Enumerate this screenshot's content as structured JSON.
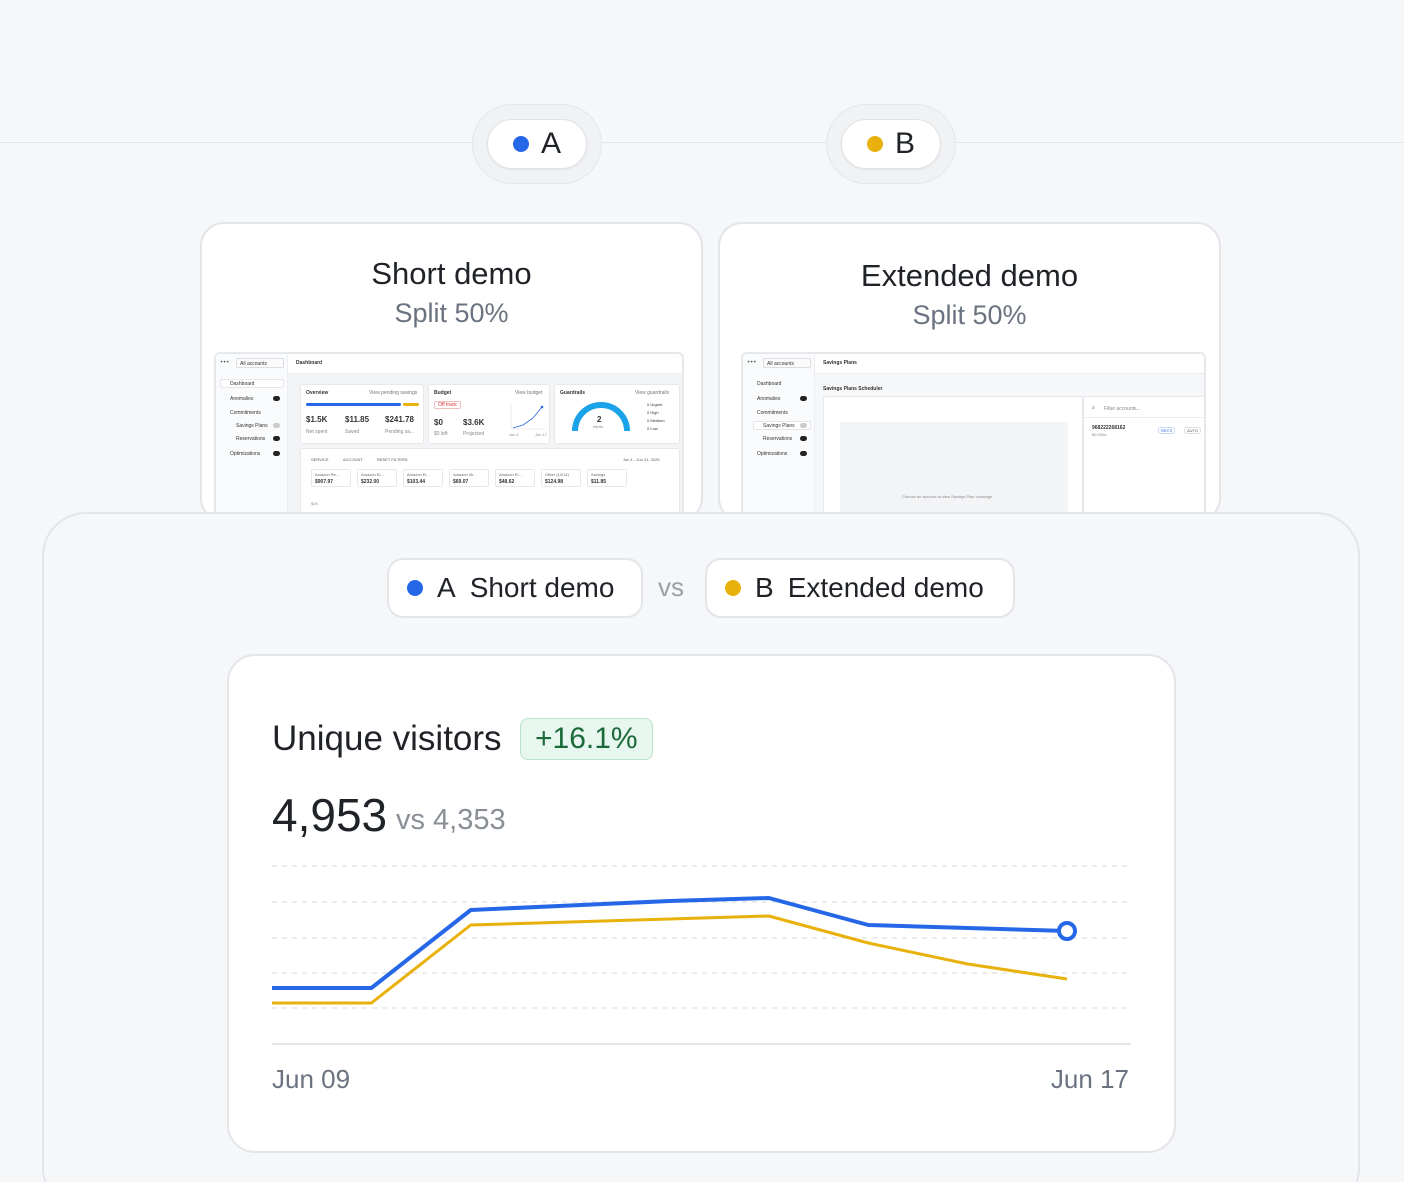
{
  "variants": {
    "a": {
      "letter": "A",
      "color": "#2667e8"
    },
    "b": {
      "letter": "B",
      "color": "#e8b10c"
    }
  },
  "demo_cards": {
    "a": {
      "title": "Short demo",
      "split": "Split 50%",
      "preview": {
        "account_select": "All accounts",
        "page": "Dashboard",
        "nav": [
          "Dashboard",
          "Anomalies",
          "Commitments",
          "Savings Plans",
          "Reservations",
          "Optimizations"
        ],
        "overview": {
          "title": "Overview",
          "link": "View pending savings",
          "values": [
            "$1.5K",
            "$11.85",
            "$241.78"
          ],
          "legend": [
            "Net spent",
            "Saved",
            "Pending sa..."
          ]
        },
        "budget": {
          "title": "Budget",
          "link": "View budget",
          "status": "Off track",
          "values": [
            "$0",
            "$3.6K"
          ],
          "legend": [
            "$0 left",
            "Projected"
          ],
          "x_labels": [
            "Jun 1",
            "Jun 17"
          ]
        },
        "guardrails": {
          "title": "Guardrails",
          "link": "View guardrails",
          "count": "2",
          "count_label": "Alerts",
          "levels": [
            "0 Urgent",
            "0 High",
            "0 Medium",
            "0 Low"
          ]
        },
        "filters": [
          "SERVICE",
          "ACCOUNT",
          "RESET FILTERS"
        ],
        "date_range": "Jun 1 - Jun 21, 2025",
        "service_tiles": [
          {
            "name": "Amazon Re...",
            "value": "$907.97"
          },
          {
            "name": "Amazon El...",
            "value": "$232.00"
          },
          {
            "name": "Amazon El...",
            "value": "$103.44"
          },
          {
            "name": "Amazon Vir...",
            "value": "$69.07"
          },
          {
            "name": "Amazon El...",
            "value": "$48.62"
          },
          {
            "name": "Other (14/14)",
            "value": "$124.98"
          },
          {
            "name": "Savings",
            "value": "$11.85"
          }
        ],
        "axis_label": "$1K"
      }
    },
    "b": {
      "title": "Extended demo",
      "split": "Split 50%",
      "preview": {
        "account_select": "All accounts",
        "page": "Savings Plans",
        "nav": [
          "Dashboard",
          "Anomalies",
          "Commitments",
          "Savings Plans",
          "Reservations",
          "Optimizations"
        ],
        "scheduler_title": "Savings Plans Scheduler",
        "empty_state": "Choose an account to view Savings Plan coverage.",
        "filter_placeholder": "Filter accounts...",
        "account_id": "968222268162",
        "account_sub": "$0.00/hr",
        "tags": [
          "RECS",
          "AUTO"
        ]
      }
    }
  },
  "comparison": {
    "a_label": "Short demo",
    "b_label": "Extended demo",
    "vs": "vs"
  },
  "metric": {
    "title": "Unique visitors",
    "delta": "+16.1%",
    "value": "4,953",
    "compare": "vs 4,353"
  },
  "chart_data": {
    "type": "line",
    "x": [
      "Jun 09",
      "Jun 10",
      "Jun 11",
      "Jun 12",
      "Jun 13",
      "Jun 14",
      "Jun 15",
      "Jun 16",
      "Jun 17"
    ],
    "x_tick_labels": [
      "Jun 09",
      "Jun 17"
    ],
    "series": [
      {
        "name": "A",
        "color": "#2667e8",
        "values": [
          0.2,
          0.2,
          0.72,
          0.75,
          0.78,
          0.8,
          0.62,
          0.6,
          0.58
        ]
      },
      {
        "name": "B",
        "color": "#e8b10c",
        "values": [
          0.1,
          0.1,
          0.62,
          0.64,
          0.66,
          0.68,
          0.5,
          0.36,
          0.26
        ]
      }
    ],
    "ylim": [
      0,
      1
    ],
    "grid": true,
    "y_scale_note": "relative values, no y-axis printed"
  }
}
